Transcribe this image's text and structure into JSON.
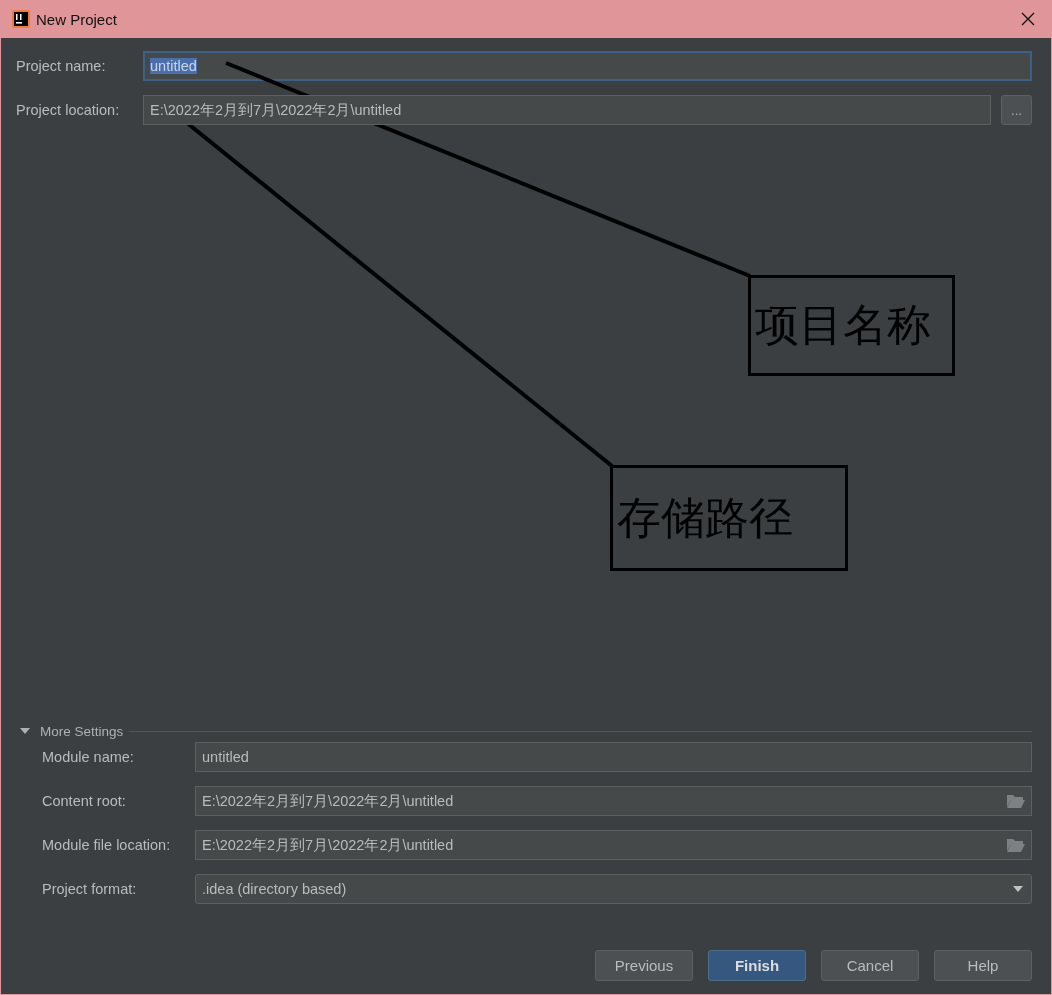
{
  "window": {
    "title": "New Project"
  },
  "fields": [
    {
      "label": "Project name:",
      "value": "untitled",
      "focused": true,
      "text_selected": true
    },
    {
      "label": "Project location:",
      "value": "E:\\2022年2月到7月\\2022年2月\\untitled",
      "focused": false,
      "text_selected": false,
      "browse": "..."
    }
  ],
  "more_settings": {
    "title": "More Settings",
    "expanded": true,
    "fields": [
      {
        "kind": "text",
        "label": "Module name:",
        "value": "untitled"
      },
      {
        "kind": "folder",
        "label": "Content root:",
        "value": "E:\\2022年2月到7月\\2022年2月\\untitled"
      },
      {
        "kind": "folder",
        "label": "Module file location:",
        "value": "E:\\2022年2月到7月\\2022年2月\\untitled"
      },
      {
        "kind": "dropdown",
        "label": "Project format:",
        "value": ".idea (directory based)"
      }
    ]
  },
  "buttons": [
    {
      "label": "Previous",
      "primary": false
    },
    {
      "label": "Finish",
      "primary": true
    },
    {
      "label": "Cancel",
      "primary": false
    },
    {
      "label": "Help",
      "primary": false
    }
  ],
  "annotations": [
    {
      "text": "项目名称"
    },
    {
      "text": "存储路径"
    }
  ]
}
